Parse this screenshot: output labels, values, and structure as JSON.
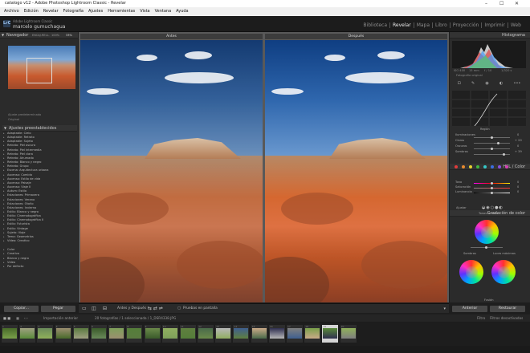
{
  "window": {
    "title": "catalogo v12 - Adobe Photoshop Lightroom Classic - Revelar",
    "min": "–",
    "max": "☐",
    "close": "✕"
  },
  "menu": [
    "Archivo",
    "Edición",
    "Revelar",
    "Fotografía",
    "Ajustes",
    "Herramientas",
    "Vista",
    "Ventana",
    "Ayuda"
  ],
  "identity": {
    "badge": "LrC",
    "product": "Adobe Lightroom Classic",
    "user": "marcelo gumuchagua"
  },
  "modules": [
    "Biblioteca",
    "Revelar",
    "Mapa",
    "Libro",
    "Proyección",
    "Imprimir",
    "Web"
  ],
  "active_module": "Revelar",
  "left": {
    "navigator_title": "Navegador",
    "zoom": [
      "ENCAJ.",
      "RELL.",
      "100%",
      "33%"
    ],
    "nav_info": [
      "Ajuste predeterminado",
      "Original"
    ],
    "presets_title": "Ajustes preestablecidos",
    "presets": [
      "Adaptable: Cielo",
      "Adaptable: Retrato",
      "Adaptable: Sujeto",
      "Retrato: Piel oscura",
      "Retrato: Piel intermedia",
      "Retrato: Piel clara",
      "Retrato: Ahumado",
      "Retrato: Blanco y negro",
      "Retrato: Grupo",
      "Escena: Arquitectura urbana",
      "Ascenso: Comida",
      "Ascenso: Estilo de vida",
      "Ascenso: Paisaje",
      "Ascenso: Viaje II",
      "Autum: Estilo",
      "Estaciones: Primavera",
      "Estaciones: Verano",
      "Estaciones: Otoño",
      "Estaciones: Invierno",
      "Estilo: Blanco y negro",
      "Estilo: Cinematográfica",
      "Estilo: Cinematográfica II",
      "Estilo: Futurista",
      "Estilo: Vintage",
      "Sujeto: Viaje",
      "Tema: Geometrías",
      "Vídeo: Creativo"
    ],
    "preset_groups": [
      "Color",
      "Creativo",
      "Blanco y negro",
      "Vídeo",
      "Por defecto"
    ],
    "copy_btn": "Copiar...",
    "paste_btn": "Pegar"
  },
  "center": {
    "before_label": "Antes",
    "after_label": "Después"
  },
  "right": {
    "histogram_title": "Histograma",
    "histo_readout": [
      "ISO 400",
      "15 mm",
      "f / 10",
      "1/320 s"
    ],
    "original_photo": "Fotografía original",
    "region_title": "Región",
    "curve_params": [
      "Iluminaciones",
      "Claros",
      "Oscuros",
      "Sombras"
    ],
    "curve_values": [
      "0",
      "+ 20",
      "0",
      "+ 39"
    ],
    "hsl_title": "HSL / Color",
    "hsl_params": [
      "Tono",
      "Saturación",
      "Luminancia"
    ],
    "hsl_values": [
      "0",
      "0",
      "0"
    ],
    "color_grading_title": "Gradación de color",
    "adjust_label": "Ajustar",
    "midtones_label": "Tonos medios",
    "shadows_label": "Sombras",
    "highlights_label": "Luces máximas",
    "fusion_label": "Fusión",
    "prev_btn": "Anterior",
    "reset_btn": "Restaurar"
  },
  "toolbar": {
    "mode": "Antes y Después :",
    "soft_proof": "Pruebas en pantalla"
  },
  "filmstrip": {
    "import_label": "Importación anterior",
    "count": "20 fotografías / 1 seleccionada / 1_DSR4338.JPG",
    "filter_label": "Filtro",
    "filter_value": "Filtros desactivados",
    "numbers": [
      "1",
      "2",
      "3",
      "4",
      "5",
      "6",
      "7",
      "8",
      "9",
      "10",
      "11",
      "12",
      "13",
      "14",
      "15",
      "16",
      "17",
      "18",
      "19",
      "20"
    ],
    "selected": 18
  },
  "colors": {
    "accent": "#f2f2f2",
    "panel": "#2b2b2b",
    "sky": "#2e66ad",
    "rock": "#c96a3a"
  }
}
